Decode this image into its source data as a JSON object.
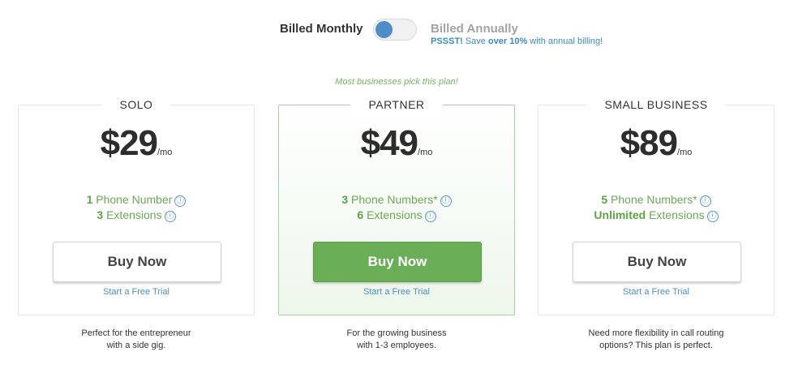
{
  "billing": {
    "monthly_label": "Billed Monthly",
    "annual_label": "Billed Annually",
    "promo_prefix": "PSSST!",
    "promo_mid": " Save ",
    "promo_emph": "over 10%",
    "promo_suffix": " with annual billing!",
    "selected": "monthly"
  },
  "recommended_label": "Most businesses pick this plan!",
  "plans": [
    {
      "name": "SOLO",
      "price": "$29",
      "unit": "/mo",
      "feature1_count": "1",
      "feature1_label": " Phone Number",
      "feature2_count": "3",
      "feature2_label": " Extensions",
      "button_label": "Buy Now",
      "trial_label": "Start a Free Trial",
      "description_line1": "Perfect for the entrepreneur",
      "description_line2": "with a side gig."
    },
    {
      "name": "PARTNER",
      "price": "$49",
      "unit": "/mo",
      "feature1_count": "3",
      "feature1_label": " Phone Numbers*",
      "feature2_count": "6",
      "feature2_label": " Extensions",
      "button_label": "Buy Now",
      "trial_label": "Start a Free Trial",
      "description_line1": "For the growing business",
      "description_line2": "with 1-3 employees."
    },
    {
      "name": "SMALL BUSINESS",
      "price": "$89",
      "unit": "/mo",
      "feature1_count": "5",
      "feature1_label": " Phone Numbers*",
      "feature2_count": "Unlimited",
      "feature2_label": " Extensions",
      "button_label": "Buy Now",
      "trial_label": "Start a Free Trial",
      "description_line1": "Need more flexibility in call routing",
      "description_line2": "options? This plan is perfect."
    }
  ],
  "icons": {
    "info": "ⓘ",
    "info_name": "info-icon"
  },
  "colors": {
    "accent_green": "#6aae56",
    "link_blue": "#4a8fcb",
    "toggle_knob": "#4d8ec9",
    "featured_border": "#9ed69a"
  }
}
